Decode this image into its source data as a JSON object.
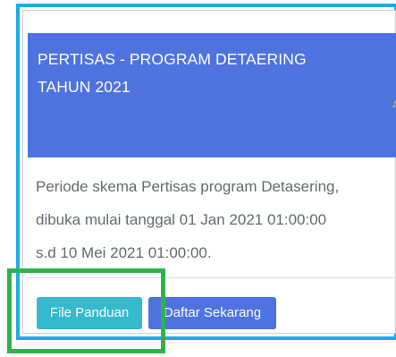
{
  "card": {
    "title": "PERTISAS - PROGRAM DETAERING TAHUN 2021",
    "body_line_1": "Periode skema Pertisas program Detasering,",
    "body_line_2": "dibuka mulai tanggal 01 Jan 2021 01:00:00",
    "body_line_3": "s.d 10 Mei 2021 01:00:00.",
    "file_button_label": "File Panduan",
    "register_button_label": "Daftar Sekarang"
  },
  "colors": {
    "header_bg": "#4e73df",
    "file_button_bg": "#36b9cc",
    "register_button_bg": "#4e73df",
    "highlight_cyan": "#1aaee8",
    "highlight_green": "#2eb34a"
  }
}
